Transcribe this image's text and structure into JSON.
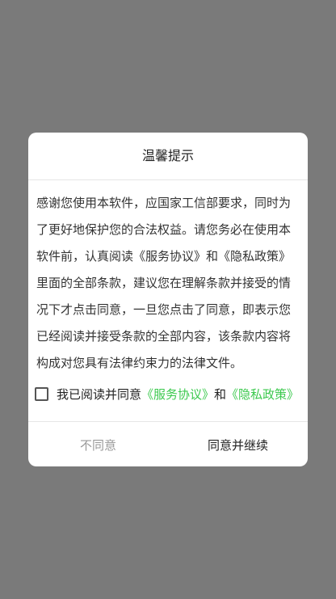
{
  "dialog": {
    "title": "温馨提示",
    "body": "感谢您使用本软件，应国家工信部要求，同时为了更好地保护您的合法权益。请您务必在使用本软件前，认真阅读《服务协议》和《隐私政策》里面的全部条款，建议您在理解条款并接受的情况下才点击同意，一旦您点击了同意，即表示您已经阅读并接受条款的全部内容，该条款内容将构成对您具有法律约束力的法律文件。",
    "agree_prefix": "我已阅读并同意",
    "service_link": "《服务协议》",
    "and_text": "和",
    "privacy_link": "《隐私政策》",
    "disagree_label": "不同意",
    "agree_label": "同意并继续"
  },
  "colors": {
    "link": "#3cc94e",
    "overlay": "#7a7a7a"
  }
}
